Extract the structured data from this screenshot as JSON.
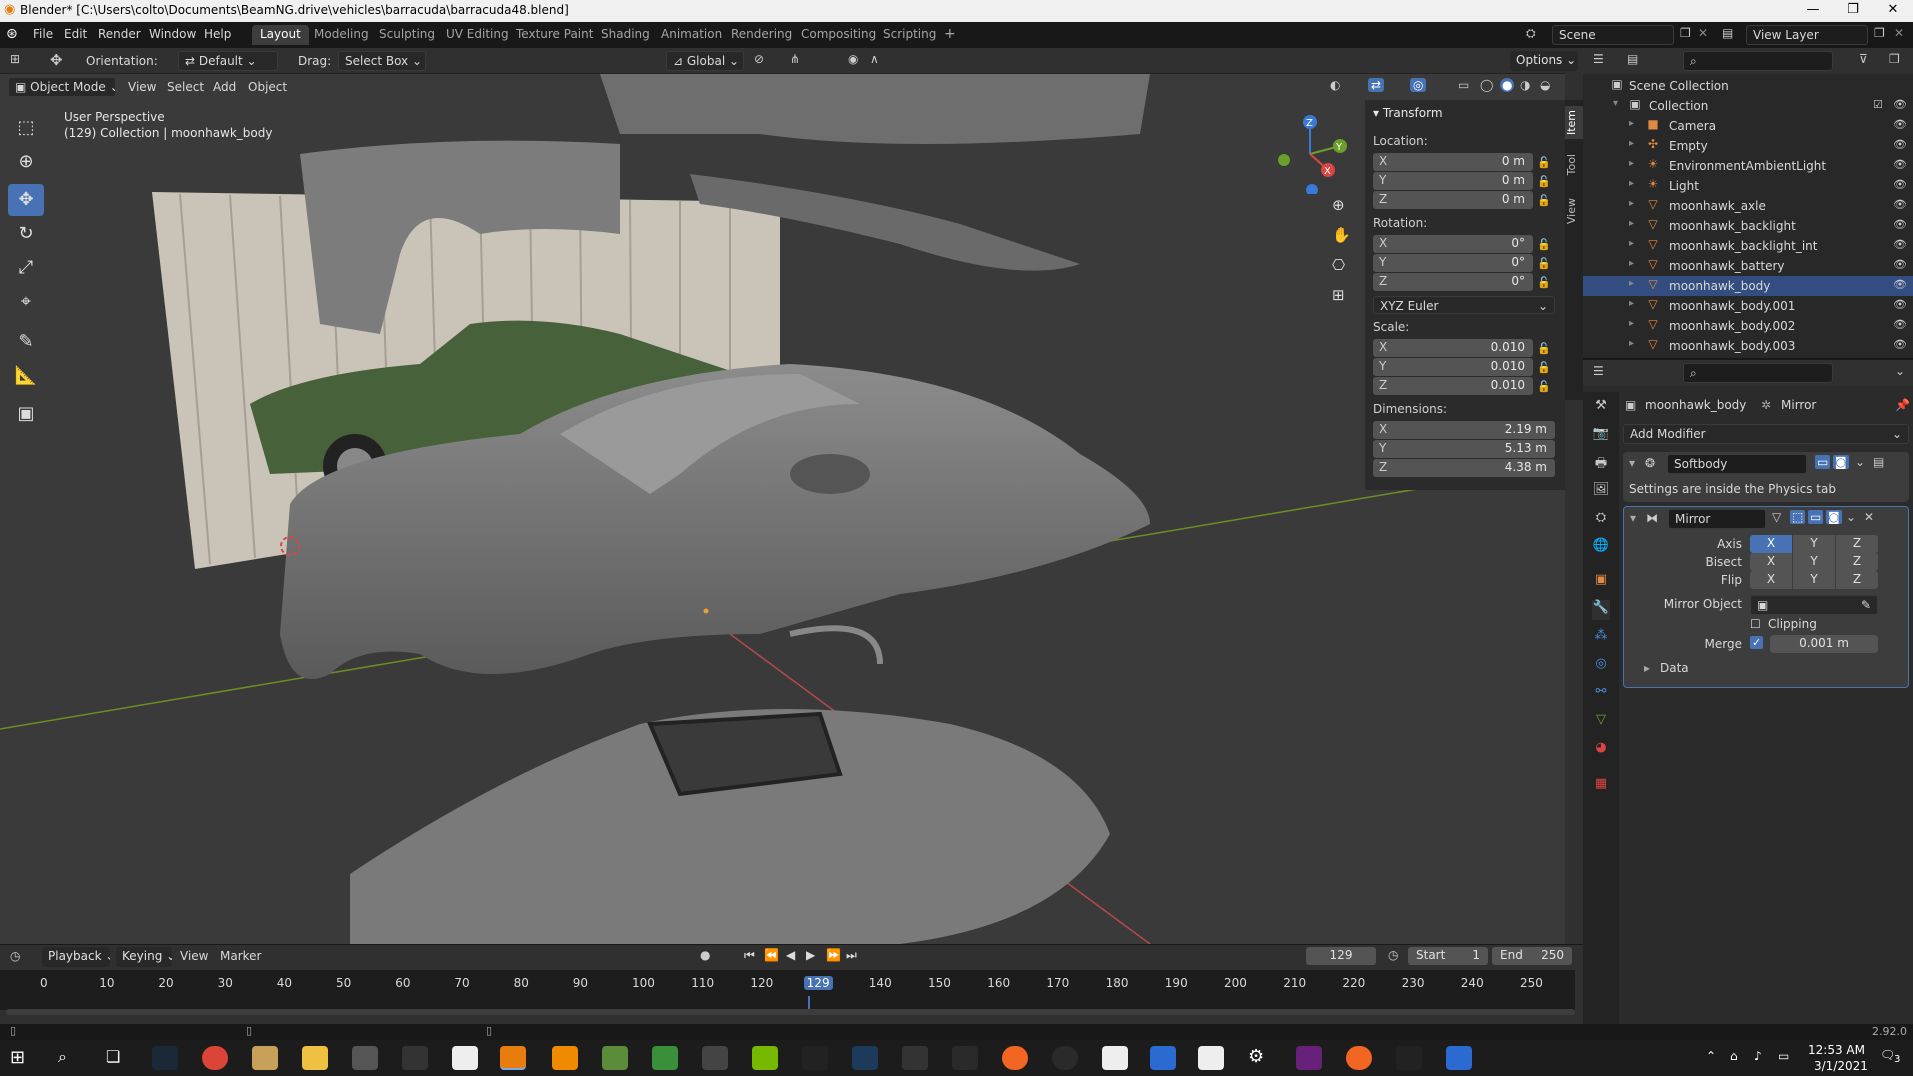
{
  "window": {
    "title": "Blender* [C:\\Users\\colto\\Documents\\BeamNG.drive\\vehicles\\barracuda\\barracuda48.blend]"
  },
  "menu": [
    "File",
    "Edit",
    "Render",
    "Window",
    "Help"
  ],
  "workspaces": [
    {
      "label": "Layout",
      "active": true
    },
    {
      "label": "Modeling"
    },
    {
      "label": "Sculpting"
    },
    {
      "label": "UV Editing"
    },
    {
      "label": "Texture Paint"
    },
    {
      "label": "Shading"
    },
    {
      "label": "Animation"
    },
    {
      "label": "Rendering"
    },
    {
      "label": "Compositing"
    },
    {
      "label": "Scripting"
    }
  ],
  "scene": {
    "label": "Scene",
    "view_layer": "View Layer"
  },
  "toolbar": {
    "orientation_label": "Orientation:",
    "orientation_value": "Default",
    "drag_label": "Drag:",
    "drag_value": "Select Box",
    "transform_orientation": "Global",
    "options": "Options"
  },
  "viewport_header": {
    "mode": "Object Mode",
    "menus": [
      "View",
      "Select",
      "Add",
      "Object"
    ]
  },
  "viewport": {
    "perspective": "User Perspective",
    "collection_info": "(129) Collection | moonhawk_body"
  },
  "npanel": {
    "section": "Transform",
    "location_label": "Location:",
    "location": {
      "x": "0 m",
      "y": "0 m",
      "z": "0 m"
    },
    "rotation_label": "Rotation:",
    "rotation": {
      "x": "0°",
      "y": "0°",
      "z": "0°"
    },
    "rotation_mode": "XYZ Euler",
    "scale_label": "Scale:",
    "scale": {
      "x": "0.010",
      "y": "0.010",
      "z": "0.010"
    },
    "dimensions_label": "Dimensions:",
    "dimensions": {
      "x": "2.19 m",
      "y": "5.13 m",
      "z": "4.38 m"
    },
    "tabs": [
      "Item",
      "Tool",
      "View"
    ]
  },
  "outliner": {
    "root": "Scene Collection",
    "collection": "Collection",
    "items": [
      {
        "name": "Camera",
        "icon": "camera-icon"
      },
      {
        "name": "Empty",
        "icon": "empty-icon"
      },
      {
        "name": "EnvironmentAmbientLight",
        "icon": "light-icon"
      },
      {
        "name": "Light",
        "icon": "light-icon"
      },
      {
        "name": "moonhawk_axle",
        "icon": "mesh-icon"
      },
      {
        "name": "moonhawk_backlight",
        "icon": "mesh-icon"
      },
      {
        "name": "moonhawk_backlight_int",
        "icon": "mesh-icon"
      },
      {
        "name": "moonhawk_battery",
        "icon": "mesh-icon"
      },
      {
        "name": "moonhawk_body",
        "icon": "mesh-icon",
        "active": true
      },
      {
        "name": "moonhawk_body.001",
        "icon": "mesh-icon"
      },
      {
        "name": "moonhawk_body.002",
        "icon": "mesh-icon"
      },
      {
        "name": "moonhawk_body.003",
        "icon": "mesh-icon"
      }
    ]
  },
  "properties": {
    "object_name": "moonhawk_body",
    "modifier_context": "Mirror",
    "add_modifier": "Add Modifier",
    "softbody": {
      "name": "Softbody",
      "note": "Settings are inside the Physics tab"
    },
    "mirror": {
      "name": "Mirror",
      "axis_label": "Axis",
      "bisect_label": "Bisect",
      "flip_label": "Flip",
      "x": "X",
      "y": "Y",
      "z": "Z",
      "mirror_object_label": "Mirror Object",
      "clipping_label": "Clipping",
      "merge_label": "Merge",
      "merge_value": "0.001 m",
      "data_label": "Data"
    }
  },
  "timeline": {
    "menus": [
      "Playback",
      "Keying",
      "View",
      "Marker"
    ],
    "current_frame": "129",
    "start_label": "Start",
    "start": "1",
    "end_label": "End",
    "end": "250",
    "ticks": [
      "0",
      "10",
      "20",
      "30",
      "40",
      "50",
      "60",
      "70",
      "80",
      "90",
      "100",
      "110",
      "120",
      "129",
      "140",
      "150",
      "160",
      "170",
      "180",
      "190",
      "200",
      "210",
      "220",
      "230",
      "240",
      "250"
    ]
  },
  "status": {
    "version": "2.92.0"
  },
  "taskbar": {
    "time": "12:53 AM",
    "date": "3/1/2021",
    "notifications": "3"
  }
}
